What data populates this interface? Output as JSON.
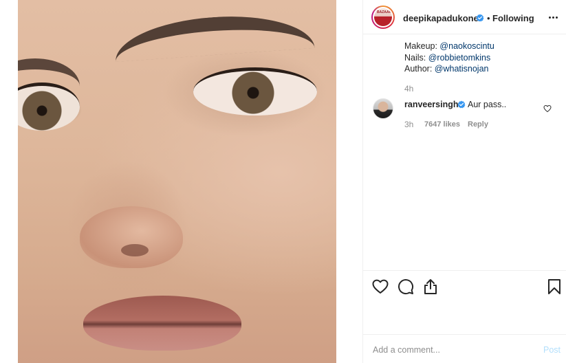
{
  "post": {
    "username": "deepikapadukone",
    "follow_separator": "•",
    "follow_status": "Following",
    "avatar_text": "BAZAAR"
  },
  "caption": {
    "lines": [
      {
        "label": "Makeup: ",
        "mention": "@naokoscintu"
      },
      {
        "label": "Nails: ",
        "mention": "@robbietomkins"
      },
      {
        "label": "Author: ",
        "mention": "@whatisnojan"
      }
    ],
    "time": "4h"
  },
  "comment": {
    "username": "ranveersingh",
    "text": "Aur pass..",
    "time": "3h",
    "likes": "7647 likes",
    "reply": "Reply"
  },
  "add_comment": {
    "placeholder": "Add a comment...",
    "post_label": "Post"
  },
  "colors": {
    "verified": "#3897f0",
    "mention": "#00376b",
    "post_disabled": "#b2dffc",
    "meta_text": "#8e8e8e"
  },
  "icons": {
    "more": "more-options-icon",
    "like": "heart-icon",
    "comment": "comment-bubble-icon",
    "share": "share-icon",
    "save": "bookmark-icon",
    "verified": "verified-badge-icon"
  }
}
